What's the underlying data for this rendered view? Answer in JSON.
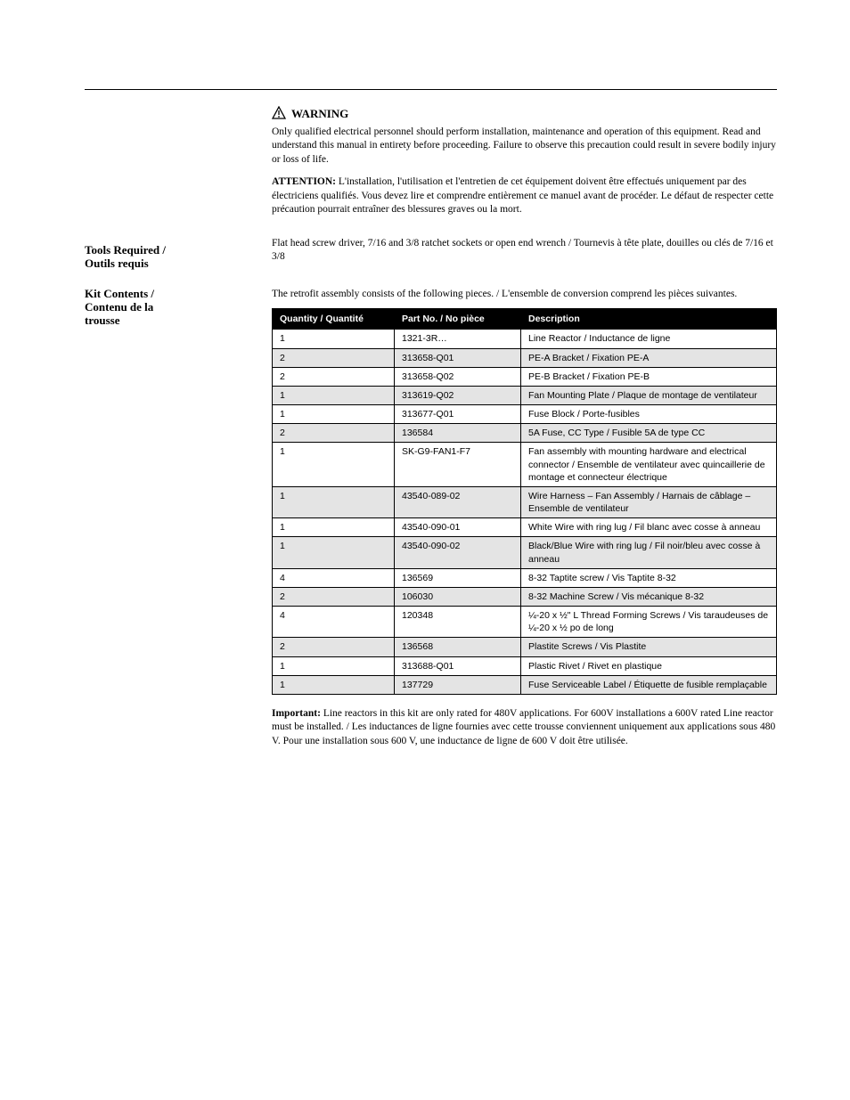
{
  "page_header_rule": true,
  "warning": {
    "label": "WARNING",
    "text_en": "Only qualified electrical personnel should perform installation, maintenance and operation of this equipment. Read and understand this manual in entirety before proceeding. Failure to observe this precaution could result in severe bodily injury or loss of life.",
    "label_fr": "ATTENTION:",
    "text_fr": "L'installation, l'utilisation et l'entretien de cet équipement doivent être effectués uniquement par des électriciens qualifiés. Vous devez lire et comprendre entièrement ce manuel avant de procéder. Le défaut de respecter cette précaution pourrait entraîner des blessures graves ou la mort."
  },
  "tools": {
    "label_lines": [
      "Tools Required /",
      "Outils requis"
    ],
    "text": "Flat head screw driver, 7/16 and 3/8 ratchet sockets or open end wrench / Tournevis à tête plate, douilles ou clés de 7/16 et 3/8"
  },
  "kit": {
    "label_lines": [
      "Kit Contents /",
      "Contenu de la",
      "trousse"
    ],
    "intro": "The retrofit assembly consists of the following pieces. / L'ensemble de conversion comprend les pièces suivantes.",
    "columns": [
      "Quantity / Quantité",
      "Part No. / No pièce",
      "Description"
    ],
    "rows": [
      {
        "qty": "1",
        "part": "1321-3R…",
        "desc": "Line Reactor / Inductance de ligne"
      },
      {
        "qty": "2",
        "part": "313658-Q01",
        "desc": "PE-A  Bracket / Fixation PE-A"
      },
      {
        "qty": "2",
        "part": "313658-Q02",
        "desc": "PE-B  Bracket / Fixation PE-B"
      },
      {
        "qty": "1",
        "part": "313619-Q02",
        "desc": "Fan Mounting Plate / Plaque de montage de ventilateur"
      },
      {
        "qty": "1",
        "part": "313677-Q01",
        "desc": "Fuse Block / Porte-fusibles"
      },
      {
        "qty": "2",
        "part": "136584",
        "desc": "5A Fuse, CC Type / Fusible 5A de type CC"
      },
      {
        "qty": "1",
        "part": "SK-G9-FAN1-F7",
        "desc": "Fan assembly with mounting hardware and electrical connector / Ensemble de ventilateur avec quincaillerie de montage et connecteur électrique"
      },
      {
        "qty": "1",
        "part": "43540-089-02",
        "desc": "Wire Harness – Fan Assembly / Harnais de câblage – Ensemble de ventilateur"
      },
      {
        "qty": "1",
        "part": "43540-090-01",
        "desc": "White Wire with ring lug / Fil blanc avec cosse à anneau"
      },
      {
        "qty": "1",
        "part": "43540-090-02",
        "desc": "Black/Blue Wire with ring lug / Fil noir/bleu avec cosse à anneau"
      },
      {
        "qty": "4",
        "part": "136569",
        "desc": "8-32 Taptite screw / Vis Taptite 8-32"
      },
      {
        "qty": "2",
        "part": "106030",
        "desc": "8-32 Machine Screw / Vis mécanique 8-32"
      },
      {
        "qty": "4",
        "part": "120348",
        "desc": "¼-20 x ½\" L Thread Forming Screws / Vis taraudeuses de ¼-20 x ½ po de long"
      },
      {
        "qty": "2",
        "part": "136568",
        "desc": "Plastite Screws / Vis Plastite"
      },
      {
        "qty": "1",
        "part": "313688-Q01",
        "desc": "Plastic Rivet / Rivet en plastique"
      },
      {
        "qty": "1",
        "part": "137729",
        "desc": "Fuse Serviceable Label / Étiquette de fusible remplaçable"
      }
    ]
  },
  "important": {
    "label": "Important:",
    "text": "Line reactors in this kit are only rated for 480V applications. For 600V installations a 600V rated Line reactor must be installed. / Les inductances de ligne fournies avec cette trousse conviennent uniquement aux applications sous 480 V. Pour une installation sous 600 V, une inductance de ligne de 600 V doit être utilisée."
  }
}
